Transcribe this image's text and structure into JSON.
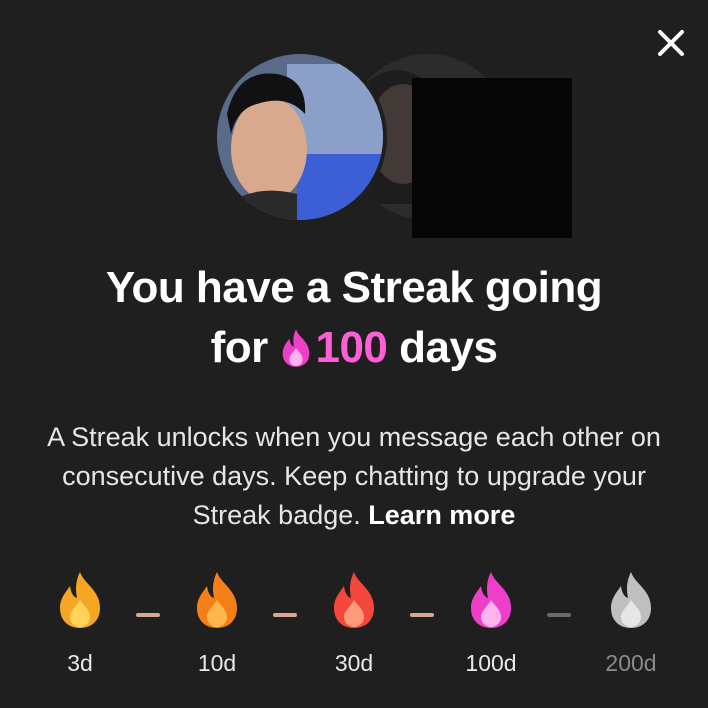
{
  "modal": {
    "close_icon": "close-icon",
    "headline_line1": "You have a Streak going",
    "headline_for": "for",
    "streak_count": "100",
    "headline_days": "days",
    "description": "A Streak unlocks when you message each other on consecutive days. Keep chatting to upgrade your Streak badge.",
    "learn_more": "Learn more"
  },
  "milestones": [
    {
      "label": "3d",
      "icon": "flame-yellow-icon",
      "color": "#f5a623",
      "inner": "#ffd35a"
    },
    {
      "label": "10d",
      "icon": "flame-orange-icon",
      "color": "#f57f17",
      "inner": "#ffb74d"
    },
    {
      "label": "30d",
      "icon": "flame-red-icon",
      "color": "#f4473b",
      "inner": "#ff9a7a"
    },
    {
      "label": "100d",
      "icon": "flame-pink-icon",
      "color": "#ee3fc8",
      "inner": "#ffb3ec"
    },
    {
      "label": "200d",
      "icon": "flame-grey-icon",
      "color": "#bfbfbf",
      "inner": "#e6e6e6",
      "locked": true
    }
  ],
  "colors": {
    "background": "#1f1f1f",
    "accent_pink": "#ff5fd4",
    "dash_active": "#d9a98f",
    "dash_locked": "#6a6a6a"
  }
}
